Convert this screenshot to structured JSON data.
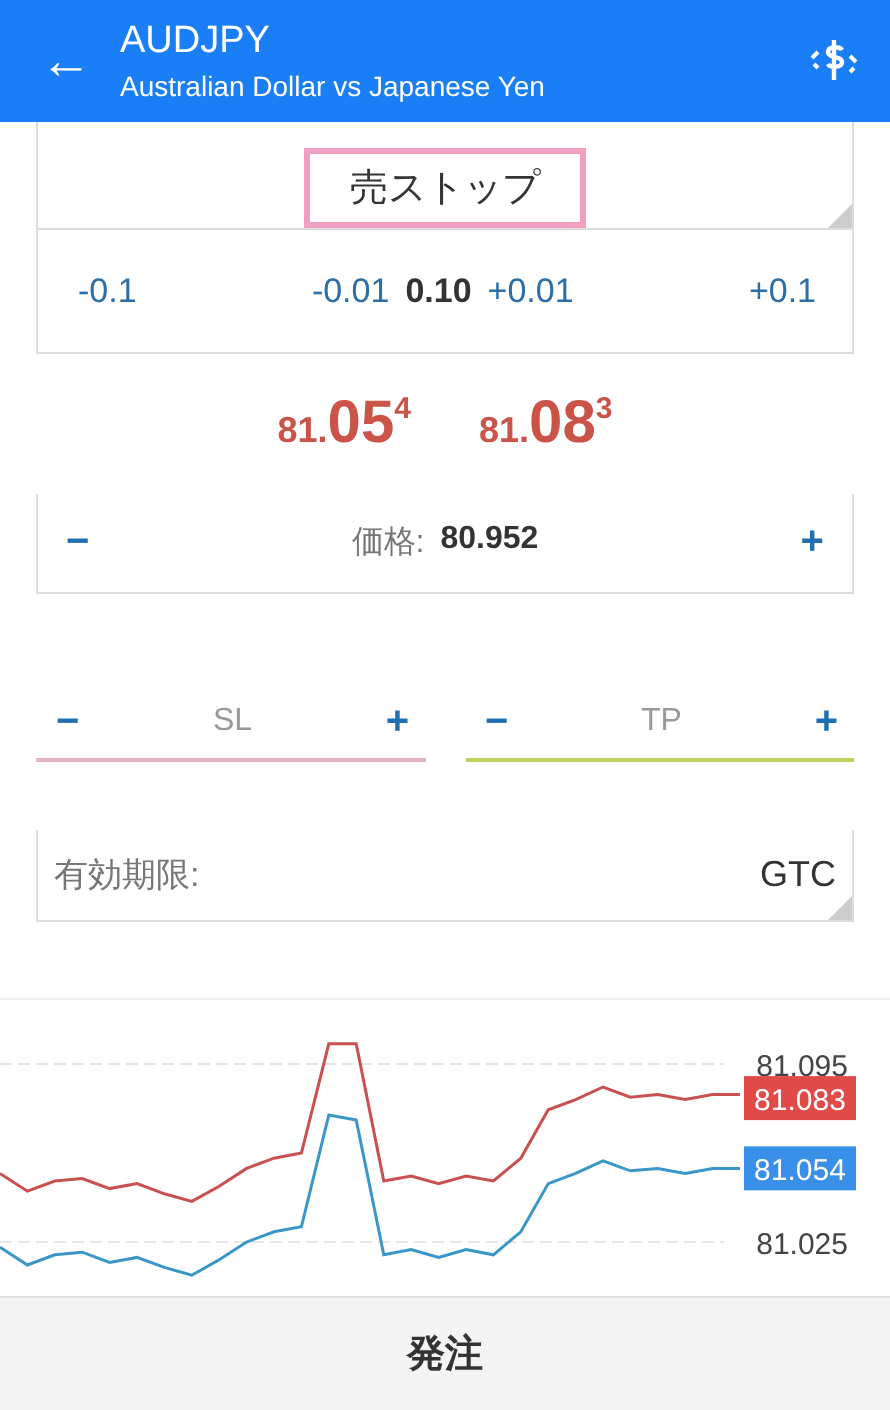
{
  "header": {
    "back": "←",
    "symbol": "AUDJPY",
    "description": "Australian Dollar vs Japanese Yen"
  },
  "order_type": {
    "value": "売ストップ",
    "highlighted": true
  },
  "volume": {
    "steps": [
      {
        "label": "-0.1",
        "kind": "step"
      },
      {
        "label": "-0.01",
        "kind": "step"
      },
      {
        "label": "0.10",
        "kind": "value"
      },
      {
        "label": "+0.01",
        "kind": "step"
      },
      {
        "label": "+0.1",
        "kind": "step"
      }
    ]
  },
  "quotes": [
    {
      "prefix": "81.",
      "big": "05",
      "pip": "4"
    },
    {
      "prefix": "81.",
      "big": "08",
      "pip": "3"
    }
  ],
  "price": {
    "minus": "−",
    "label": "価格:",
    "value": "80.952",
    "plus": "+"
  },
  "stops": [
    {
      "minus": "−",
      "placeholder": "SL",
      "plus": "+",
      "color": "#e2b3bd"
    },
    {
      "minus": "−",
      "placeholder": "TP",
      "plus": "+",
      "color": "#c3cf5e"
    }
  ],
  "expiration": {
    "label": "有効期限:",
    "value": "GTC"
  },
  "chart": {
    "chart_data": {
      "type": "line",
      "ylim": [
        81.003,
        81.121
      ],
      "yticks": [
        81.025,
        81.095
      ],
      "series": [
        {
          "color": "#c9504f",
          "values": [
            81.052,
            81.045,
            81.049,
            81.05,
            81.046,
            81.048,
            81.044,
            81.041,
            81.047,
            81.054,
            81.058,
            81.06,
            81.103,
            81.103,
            81.049,
            81.051,
            81.048,
            81.051,
            81.049,
            81.058,
            81.077,
            81.081,
            81.086,
            81.082,
            81.083,
            81.081,
            81.083,
            81.083
          ]
        },
        {
          "color": "#3a95c8",
          "values": [
            81.023,
            81.016,
            81.02,
            81.021,
            81.017,
            81.019,
            81.015,
            81.012,
            81.018,
            81.025,
            81.029,
            81.031,
            81.075,
            81.073,
            81.02,
            81.022,
            81.019,
            81.022,
            81.02,
            81.029,
            81.048,
            81.052,
            81.057,
            81.053,
            81.054,
            81.052,
            81.054,
            81.054
          ]
        }
      ]
    },
    "price_tags": [
      {
        "label": "81.083",
        "color": "#e04a48"
      },
      {
        "label": "81.054",
        "color": "#3a8fe8"
      }
    ]
  },
  "submit": "発注"
}
